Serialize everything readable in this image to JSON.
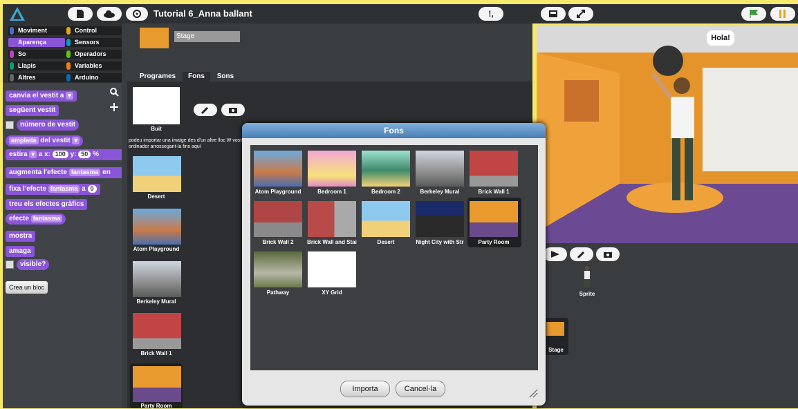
{
  "topbar": {
    "title": "Tutorial 6_Anna ballant",
    "hint_label": "!,"
  },
  "categories": [
    {
      "label": "Moviment",
      "color": "#4a6cd4"
    },
    {
      "label": "Control",
      "color": "#e1a91a"
    },
    {
      "label": "Aparença",
      "color": "#8a55d7"
    },
    {
      "label": "Sensors",
      "color": "#0e9ac2"
    },
    {
      "label": "So",
      "color": "#bb42c3"
    },
    {
      "label": "Operadors",
      "color": "#62c213"
    },
    {
      "label": "Llapis",
      "color": "#0e9a6c"
    },
    {
      "label": "Variables",
      "color": "#ee7d16"
    },
    {
      "label": "Altres",
      "color": "#666666"
    },
    {
      "label": "Arduino",
      "color": "#0a6ba6"
    }
  ],
  "blocks": {
    "switch_costume": "canvia el vestit a",
    "next_costume": "següent vestit",
    "costume_number": "número de vestit",
    "width_of": "amplada",
    "of_costume": "del vestit",
    "stretch": "estira",
    "to_x": "a x:",
    "x_val": "100",
    "y_label": "y:",
    "y_val": "50",
    "percent": "%",
    "change_effect": "augmenta l'efecte",
    "effect_name": "fantasma",
    "by": "en",
    "set_effect": "fixa l'efecte",
    "to": "a",
    "set_val": "0",
    "clear_effects": "treu els efectes gràfics",
    "effect": "efecte",
    "show": "mostra",
    "hide": "amaga",
    "visible": "visible?",
    "make_block": "Crea un bloc"
  },
  "stage_header": {
    "name": "Stage"
  },
  "tabs": [
    "Programes",
    "Fons",
    "Sons"
  ],
  "backdrops": [
    {
      "label": "Buit"
    },
    {
      "label": "Desert"
    },
    {
      "label": "Atom Playground"
    },
    {
      "label": "Berkeley Mural"
    },
    {
      "label": "Brick Wall 1"
    },
    {
      "label": "Party Room"
    }
  ],
  "import_hint": "podeu importar una imatge des d'un altre lloc W vostre ordinador arrossegant-la fins aquí",
  "stage": {
    "speech": "Hola!"
  },
  "sprites": [
    {
      "label": "Sprite"
    },
    {
      "label": "Stage"
    }
  ],
  "dialog": {
    "title": "Fons",
    "items": [
      {
        "label": "Atom Playground"
      },
      {
        "label": "Bedroom 1"
      },
      {
        "label": "Bedroom 2"
      },
      {
        "label": "Berkeley Mural"
      },
      {
        "label": "Brick Wall 1"
      },
      {
        "label": "Brick Wall 2"
      },
      {
        "label": "Brick Wall and Stai"
      },
      {
        "label": "Desert"
      },
      {
        "label": "Night City with Str"
      },
      {
        "label": "Party Room"
      },
      {
        "label": "Pathway"
      },
      {
        "label": "XY Grid"
      }
    ],
    "import_button": "Importa",
    "cancel_button": "Cancel·la"
  }
}
